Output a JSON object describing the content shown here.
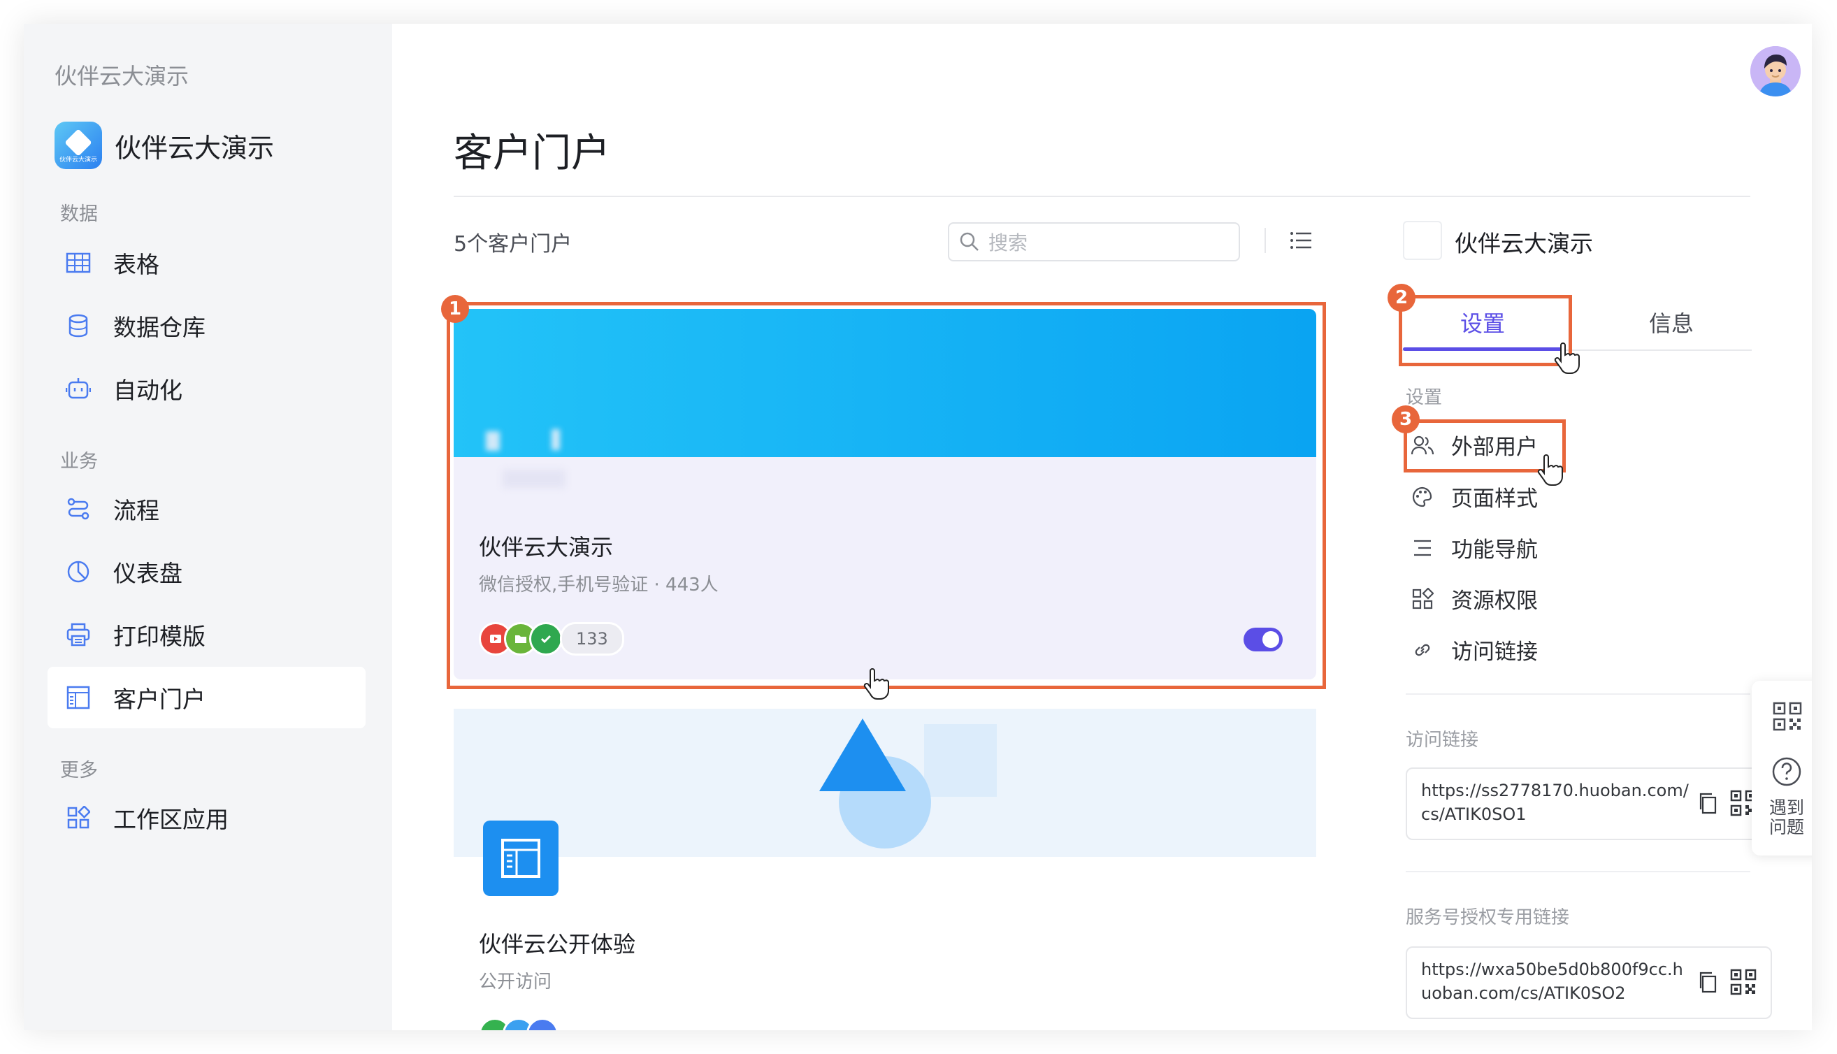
{
  "workspace_label": "伙伴云大演示",
  "brand": {
    "name": "伙伴云大演示",
    "logo_text": "伙伴云大演示"
  },
  "sidebar": {
    "sections": {
      "data": "数据",
      "business": "业务",
      "more": "更多"
    },
    "items": [
      {
        "label": "表格",
        "icon": "table-icon"
      },
      {
        "label": "数据仓库",
        "icon": "database-icon"
      },
      {
        "label": "自动化",
        "icon": "robot-icon"
      },
      {
        "label": "流程",
        "icon": "flow-icon"
      },
      {
        "label": "仪表盘",
        "icon": "dashboard-icon"
      },
      {
        "label": "打印模版",
        "icon": "printer-icon"
      },
      {
        "label": "客户门户",
        "icon": "portal-icon",
        "active": true
      },
      {
        "label": "工作区应用",
        "icon": "apps-icon"
      }
    ]
  },
  "main": {
    "title": "客户门户",
    "count": "5个客户门户",
    "search_placeholder": "搜索",
    "cards": [
      {
        "title": "伙伴云大演示",
        "subtitle": "微信授权,手机号验证 · 443人",
        "member_count": "133",
        "enabled": true
      },
      {
        "title": "伙伴云公开体验",
        "subtitle": "公开访问"
      }
    ]
  },
  "panel": {
    "name": "伙伴云大演示",
    "tabs": [
      "设置",
      "信息"
    ],
    "section_label": "设置",
    "menu": [
      {
        "label": "外部用户",
        "icon": "users-icon"
      },
      {
        "label": "页面样式",
        "icon": "palette-icon"
      },
      {
        "label": "功能导航",
        "icon": "menu-lines-icon"
      },
      {
        "label": "资源权限",
        "icon": "grid-icon"
      },
      {
        "label": "访问链接",
        "icon": "link-icon"
      }
    ],
    "access_link_label": "访问链接",
    "access_link": "https://ss2778170.huoban.com/cs/ATIK0SO1",
    "service_link_label": "服务号授权专用链接",
    "service_link": "https://wxa50be5d0b800f9cc.huoban.com/cs/ATIK0SO2"
  },
  "float": {
    "help_text": "遇到问题"
  },
  "annotations": [
    "1",
    "2",
    "3"
  ],
  "colors": {
    "accent": "#5b4ee6",
    "highlight": "#e8663b",
    "cover": "#0aa4f2"
  }
}
